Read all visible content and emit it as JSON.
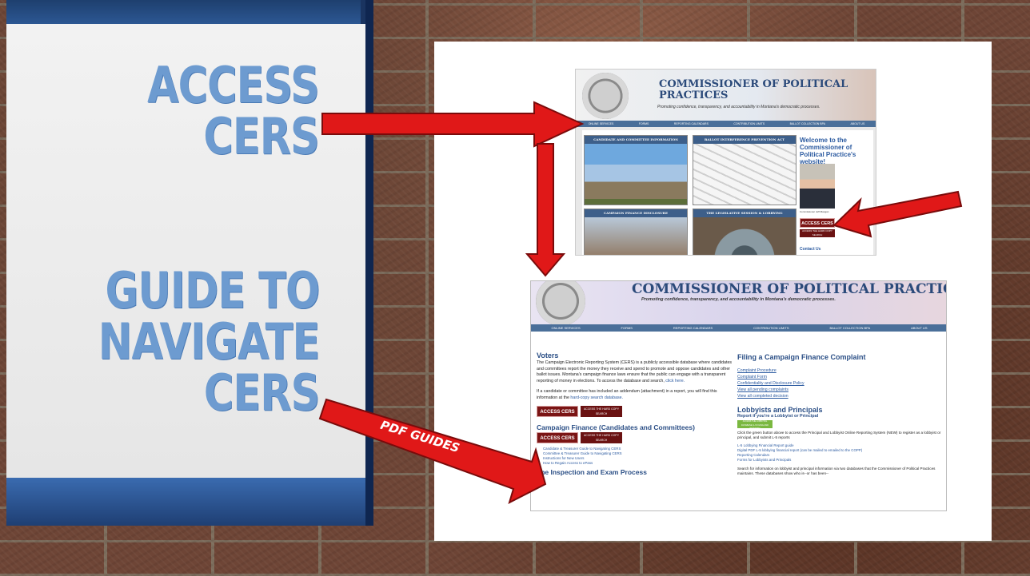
{
  "slide": {
    "title_access_line1": "ACCESS",
    "title_access_line2": "CERS",
    "title_guide_line1": "GUIDE TO",
    "title_guide_line2": "NAVIGATE",
    "title_guide_line3": "CERS",
    "arrow_label": "PDF GUIDES"
  },
  "colors": {
    "title_blue": "#6d9bd0",
    "panel_navy": "#1e3f6e",
    "arrow_red": "#e01818"
  },
  "homepage": {
    "title_line1": "COMMISSIONER OF POLITICAL",
    "title_line2": "PRACTICES",
    "tagline": "Promoting confidence, transparency, and accountability in Montana's democratic processes.",
    "nav": [
      "ONLINE SERVICES",
      "FORMS",
      "REPORTING CALENDARS",
      "CONTRIBUTION LIMITS",
      "BALLOT COLLECTION BPA",
      "ABOUT US"
    ],
    "tiles": [
      "CANDIDATE AND COMMITTEE INFORMATION",
      "BALLOT INTERFERENCE PREVENTION ACT",
      "CAMPAIGN FINANCE DISCLOSURE",
      "THE LEGISLATIVE SESSION & LOBBYING"
    ],
    "welcome": "Welcome to the Commissioner of Political Practice's website!",
    "photo_caption": "Commissioner Jeff Mangan",
    "access_cers_button": "ACCESS CERS",
    "hardcopy_button": "ACCESS THE HARD COPY SEARCH",
    "contact": "Contact Us"
  },
  "cers_page": {
    "title": "COMMISSIONER OF POLITICAL PRACTICES",
    "tagline": "Promoting confidence, transparency, and accountability in Montana's democratic processes.",
    "nav": [
      "ONLINE SERVICES",
      "FORMS",
      "REPORTING CALENDARS",
      "CONTRIBUTION LIMITS",
      "BALLOT COLLECTION BPA",
      "ABOUT US"
    ],
    "voters_heading": "Voters",
    "voters_text": "The Campaign Electronic Reporting System (CERS) is a publicly accessible database where candidates and committees report the money they receive and spend to promote and oppose candidates and other ballot issues. Montana's campaign finance laws ensure that the public can engage with a transparent reporting of money in elections. To access the database and search,",
    "voters_link": "click here.",
    "addendum_text": "If a candidate or committee has included an addendum (attachment) in a report, you will find this information at the",
    "addendum_link": "hard-copy search database.",
    "access_cers_button": "ACCESS CERS",
    "hardcopy_button": "ACCESS THE HARD COPY SEARCH",
    "campaign_heading": "Campaign Finance (Candidates and Committees)",
    "campaign_links": [
      "Candidate & Treasurer Guide to Navigating CERS",
      "Committee & Treasurer Guide to Navigating CERS",
      "Instructions for New Users",
      "How to Regain Access to ePass"
    ],
    "inspection_heading": "The Inspection and Exam Process",
    "filing_heading": "Filing a Campaign Finance Complaint",
    "filing_links": [
      "Complaint Procedure",
      "Complaint Form",
      "Confidentiality and Disclosure Policy",
      "View all pending complaints",
      "View all completed decision"
    ],
    "lobby_heading": "Lobbyists and Principals",
    "lobby_sub": "Report if you're a Lobbyist or Principal",
    "lobby_button": "ACCESS THE LOBBYING DATABASE (L-5 FILING AND REPORTS)",
    "lobby_text": "Click the green button above to access the Principal and Lobbyist Online Reporting System (NEW) to register as a lobbyist or principal, and submit L-5 reports",
    "lobby_links": [
      "L-5 Lobbying Financial Report guide",
      "Digital PDF L-5 lobbying financial report (can be mailed to emailed to the COPP)",
      "Reporting Calendars",
      "Forms for Lobbyists and Principals"
    ],
    "search_text": "Search for information on lobbyist and principal information via two databases that the Commissioner of Political Practices maintains. These databases show who is--or has been--"
  }
}
